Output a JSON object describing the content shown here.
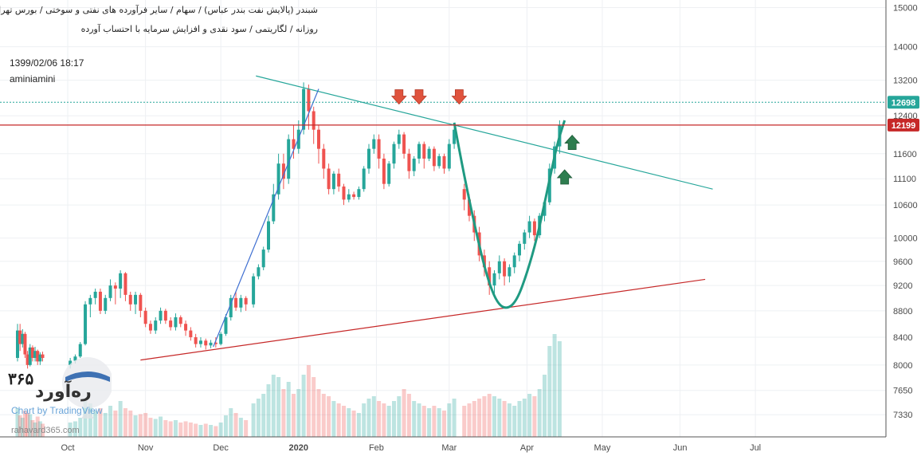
{
  "header": {
    "line1": "شبندر (پالایش نفت بندر عباس) / سهام / سایر فرآورده های نفتی و سوختی / بورس تهران",
    "line2": "روزانه / لگاریتمی / سود نقدی و افزایش سرمایه با احتساب آورده"
  },
  "meta": {
    "datetime": "1399/02/06 18:17",
    "author": "aminiamini"
  },
  "watermark": {
    "brand_fa": "ره‌آورد",
    "brand_num": "۳۶۵",
    "url": "rahavard365.com",
    "chart_by": "Chart by TradingView"
  },
  "colors": {
    "up": "#26a69a",
    "down": "#ef5350",
    "resistance_line": "#c62828",
    "last_price_line": "#26a69a",
    "trend_upper": "#26a69a",
    "trend_lower": "#c62828",
    "rally_line": "#3f6fd1",
    "cup_curve": "#1f9a82",
    "arrow_down": "#e0533d",
    "arrow_up": "#2e7d4f"
  },
  "chart_data": {
    "type": "candlestick",
    "scale": "log",
    "ylim": [
      7050,
      15200
    ],
    "yticks": [
      7330,
      7650,
      8000,
      8400,
      8800,
      9200,
      9600,
      10000,
      10600,
      11100,
      11600,
      12400,
      13200,
      14000,
      15000
    ],
    "xticks": [
      {
        "label": "Oct",
        "day": 0
      },
      {
        "label": "Nov",
        "day": 31
      },
      {
        "label": "Dec",
        "day": 61
      },
      {
        "label": "2020",
        "day": 92
      },
      {
        "label": "Feb",
        "day": 123
      },
      {
        "label": "Mar",
        "day": 152
      },
      {
        "label": "Apr",
        "day": 183
      },
      {
        "label": "May",
        "day": 213
      },
      {
        "label": "Jun",
        "day": 244
      },
      {
        "label": "Jul",
        "day": 274
      }
    ],
    "price_labels": [
      {
        "value": 12698,
        "text": "12698",
        "role": "last"
      },
      {
        "value": 12199,
        "text": "12199",
        "role": "resistance"
      }
    ],
    "trendlines": [
      {
        "name": "upper",
        "points": [
          [
            75,
            13300
          ],
          [
            257,
            10900
          ]
        ]
      },
      {
        "name": "lower",
        "points": [
          [
            29,
            8070
          ],
          [
            254,
            9300
          ]
        ]
      },
      {
        "name": "rally",
        "points": [
          [
            58,
            8260
          ],
          [
            100,
            13000
          ]
        ]
      }
    ],
    "cup_curve": {
      "points": [
        [
          154,
          12250
        ],
        [
          158,
          11150
        ],
        [
          163,
          10050
        ],
        [
          167,
          9350
        ],
        [
          171,
          8920
        ],
        [
          175,
          8820
        ],
        [
          179,
          8960
        ],
        [
          183,
          9400
        ],
        [
          187,
          10000
        ],
        [
          191,
          10850
        ],
        [
          195,
          11800
        ],
        [
          198,
          12300
        ]
      ]
    },
    "arrows": [
      {
        "dir": "down",
        "day": 132,
        "value": 12800
      },
      {
        "dir": "down",
        "day": 140,
        "value": 12800
      },
      {
        "dir": "down",
        "day": 156,
        "value": 12800
      },
      {
        "dir": "up",
        "day": 201,
        "value": 11850
      },
      {
        "dir": "up",
        "day": 198,
        "value": 11150
      }
    ],
    "candles": [
      [
        -20,
        8100,
        8500,
        8600,
        8050,
        120
      ],
      [
        -19,
        8500,
        8300,
        8600,
        8200,
        90
      ],
      [
        -18,
        8300,
        8450,
        8520,
        8250,
        80
      ],
      [
        -17,
        8450,
        8150,
        8480,
        8100,
        110
      ],
      [
        -16,
        8150,
        8000,
        8200,
        7950,
        100
      ],
      [
        -15,
        8000,
        8250,
        8300,
        7980,
        95
      ],
      [
        -14,
        8250,
        8100,
        8280,
        8050,
        70
      ],
      [
        -13,
        8100,
        8200,
        8260,
        8050,
        60
      ],
      [
        -12,
        8200,
        8050,
        8220,
        8000,
        85
      ],
      [
        -11,
        8050,
        8150,
        8180,
        8000,
        65
      ],
      [
        -10,
        8150,
        8100,
        8190,
        8050,
        55
      ],
      [
        1,
        8000,
        8060,
        8100,
        7950,
        60
      ],
      [
        3,
        8060,
        8120,
        8150,
        8020,
        65
      ],
      [
        5,
        8120,
        8300,
        8330,
        8100,
        80
      ],
      [
        7,
        8300,
        8900,
        8950,
        8280,
        150
      ],
      [
        9,
        8900,
        9000,
        9050,
        8700,
        140
      ],
      [
        11,
        9000,
        9100,
        9150,
        8900,
        110
      ],
      [
        13,
        9100,
        8800,
        9150,
        8750,
        120
      ],
      [
        15,
        8800,
        9000,
        9050,
        8750,
        100
      ],
      [
        17,
        9000,
        9200,
        9300,
        8950,
        130
      ],
      [
        19,
        9200,
        9150,
        9250,
        8900,
        110
      ],
      [
        21,
        9150,
        9400,
        9450,
        9000,
        150
      ],
      [
        23,
        9400,
        9050,
        9420,
        8950,
        120
      ],
      [
        25,
        9050,
        8900,
        9100,
        8800,
        110
      ],
      [
        27,
        8900,
        9050,
        9100,
        8750,
        90
      ],
      [
        29,
        9050,
        8800,
        9080,
        8700,
        95
      ],
      [
        31,
        8800,
        8600,
        8850,
        8550,
        100
      ],
      [
        33,
        8600,
        8500,
        8650,
        8450,
        80
      ],
      [
        35,
        8500,
        8650,
        8700,
        8450,
        75
      ],
      [
        37,
        8650,
        8800,
        8850,
        8600,
        85
      ],
      [
        39,
        8800,
        8650,
        8830,
        8600,
        70
      ],
      [
        41,
        8650,
        8550,
        8700,
        8500,
        65
      ],
      [
        43,
        8550,
        8700,
        8760,
        8500,
        70
      ],
      [
        45,
        8700,
        8600,
        8730,
        8550,
        60
      ],
      [
        47,
        8600,
        8500,
        8650,
        8420,
        65
      ],
      [
        49,
        8500,
        8400,
        8550,
        8350,
        60
      ],
      [
        51,
        8400,
        8300,
        8450,
        8250,
        55
      ],
      [
        53,
        8300,
        8350,
        8400,
        8250,
        50
      ],
      [
        55,
        8350,
        8280,
        8380,
        8220,
        55
      ],
      [
        57,
        8280,
        8320,
        8360,
        8240,
        50
      ],
      [
        59,
        8320,
        8300,
        8400,
        8250,
        45
      ],
      [
        61,
        8300,
        8450,
        8480,
        8280,
        60
      ],
      [
        63,
        8450,
        8700,
        8750,
        8420,
        90
      ],
      [
        65,
        8700,
        9000,
        9050,
        8650,
        120
      ],
      [
        67,
        9000,
        8850,
        9100,
        8800,
        100
      ],
      [
        69,
        8850,
        9000,
        9050,
        8780,
        80
      ],
      [
        71,
        9000,
        8900,
        9030,
        8800,
        70
      ],
      [
        74,
        8900,
        9350,
        9400,
        8850,
        140
      ],
      [
        76,
        9350,
        9500,
        9550,
        9300,
        160
      ],
      [
        78,
        9500,
        9800,
        9850,
        9450,
        180
      ],
      [
        80,
        9800,
        10300,
        10400,
        9750,
        220
      ],
      [
        82,
        10300,
        10800,
        11000,
        10250,
        260
      ],
      [
        84,
        10800,
        11400,
        11600,
        10700,
        250
      ],
      [
        86,
        11400,
        11100,
        11600,
        10900,
        200
      ],
      [
        88,
        11100,
        11900,
        12000,
        11000,
        230
      ],
      [
        90,
        11900,
        11700,
        12200,
        11500,
        180
      ],
      [
        92,
        11700,
        12100,
        12300,
        11600,
        200
      ],
      [
        94,
        12100,
        13000,
        13150,
        12000,
        260
      ],
      [
        96,
        13000,
        12500,
        13100,
        12100,
        300
      ],
      [
        98,
        12500,
        12100,
        12600,
        11800,
        250
      ],
      [
        100,
        12100,
        11700,
        12200,
        11400,
        200
      ],
      [
        102,
        11700,
        11300,
        11800,
        11100,
        180
      ],
      [
        104,
        11300,
        10900,
        11400,
        10800,
        170
      ],
      [
        106,
        10900,
        11200,
        11250,
        10800,
        150
      ],
      [
        108,
        11200,
        10950,
        11300,
        10850,
        140
      ],
      [
        110,
        10950,
        10700,
        11000,
        10600,
        130
      ],
      [
        112,
        10700,
        10800,
        10900,
        10650,
        120
      ],
      [
        114,
        10800,
        10750,
        10850,
        10700,
        110
      ],
      [
        116,
        10750,
        10900,
        10950,
        10700,
        100
      ],
      [
        118,
        10900,
        11300,
        11350,
        10850,
        140
      ],
      [
        120,
        11300,
        11700,
        11800,
        11200,
        160
      ],
      [
        122,
        11700,
        11900,
        12000,
        11600,
        170
      ],
      [
        124,
        11900,
        11500,
        12000,
        11300,
        150
      ],
      [
        126,
        11500,
        11000,
        11600,
        10900,
        140
      ],
      [
        128,
        11000,
        11400,
        11450,
        10950,
        130
      ],
      [
        130,
        11400,
        11800,
        11850,
        11300,
        150
      ],
      [
        132,
        11800,
        12000,
        12100,
        11700,
        170
      ],
      [
        134,
        12000,
        11600,
        12050,
        11500,
        200
      ],
      [
        136,
        11600,
        11250,
        11700,
        11100,
        180
      ],
      [
        138,
        11250,
        11500,
        11550,
        11150,
        150
      ],
      [
        140,
        11500,
        11800,
        11850,
        11400,
        140
      ],
      [
        142,
        11800,
        11500,
        11850,
        11300,
        130
      ],
      [
        144,
        11500,
        11700,
        11750,
        11450,
        120
      ],
      [
        146,
        11700,
        11350,
        11750,
        11250,
        130
      ],
      [
        148,
        11350,
        11550,
        11600,
        11300,
        120
      ],
      [
        150,
        11550,
        11300,
        11600,
        11200,
        110
      ],
      [
        152,
        11300,
        11800,
        11900,
        11250,
        140
      ],
      [
        154,
        11800,
        12100,
        12200,
        11700,
        160
      ],
      [
        158,
        10900,
        10700,
        11000,
        10500,
        130
      ],
      [
        160,
        10700,
        10400,
        10800,
        10300,
        140
      ],
      [
        162,
        10400,
        10100,
        10500,
        9950,
        150
      ],
      [
        164,
        10100,
        9700,
        10200,
        9600,
        160
      ],
      [
        166,
        9700,
        9500,
        9800,
        9350,
        170
      ],
      [
        168,
        9500,
        9200,
        9600,
        9050,
        180
      ],
      [
        170,
        9200,
        9400,
        9450,
        9050,
        170
      ],
      [
        172,
        9400,
        9600,
        9700,
        9300,
        160
      ],
      [
        174,
        9600,
        9350,
        9650,
        9200,
        150
      ],
      [
        176,
        9350,
        9500,
        9550,
        9250,
        140
      ],
      [
        178,
        9500,
        9700,
        9750,
        9400,
        130
      ],
      [
        180,
        9700,
        9900,
        9950,
        9600,
        150
      ],
      [
        182,
        9900,
        10100,
        10150,
        9800,
        160
      ],
      [
        184,
        10100,
        10300,
        10400,
        10000,
        180
      ],
      [
        186,
        10300,
        10050,
        10350,
        9950,
        170
      ],
      [
        188,
        10050,
        10400,
        10450,
        10000,
        200
      ],
      [
        190,
        10400,
        10650,
        10700,
        10300,
        260
      ],
      [
        192,
        10650,
        11300,
        11400,
        10600,
        380
      ],
      [
        194,
        11300,
        11750,
        11850,
        11200,
        430
      ],
      [
        196,
        11750,
        12200,
        12300,
        11600,
        400
      ]
    ]
  }
}
